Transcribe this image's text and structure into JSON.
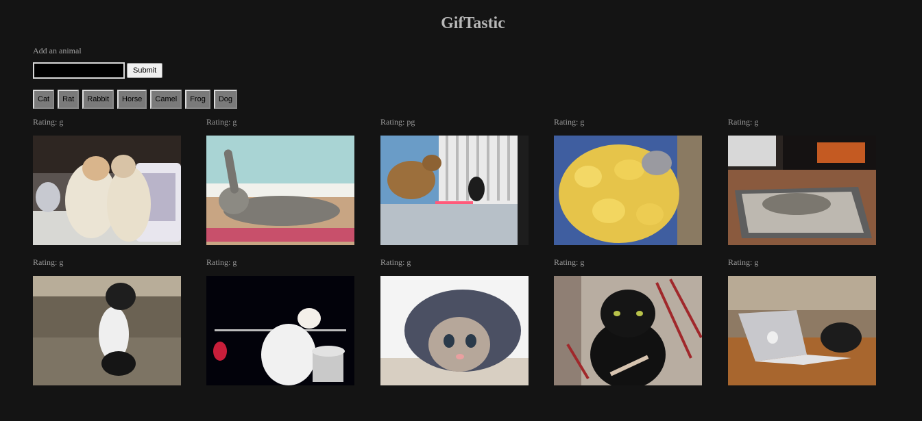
{
  "page": {
    "title": "GifTastic"
  },
  "form": {
    "label": "Add an animal",
    "input_value": "",
    "submit_label": "Submit"
  },
  "animal_buttons": [
    "Cat",
    "Rat",
    "Rabbit",
    "Horse",
    "Camel",
    "Frog",
    "Dog"
  ],
  "gifs": [
    {
      "rating": "Rating: g"
    },
    {
      "rating": "Rating: g"
    },
    {
      "rating": "Rating: pg"
    },
    {
      "rating": "Rating: g"
    },
    {
      "rating": "Rating: g"
    },
    {
      "rating": "Rating: g"
    },
    {
      "rating": "Rating: g"
    },
    {
      "rating": "Rating: g"
    },
    {
      "rating": "Rating: g"
    },
    {
      "rating": "Rating: g"
    }
  ]
}
